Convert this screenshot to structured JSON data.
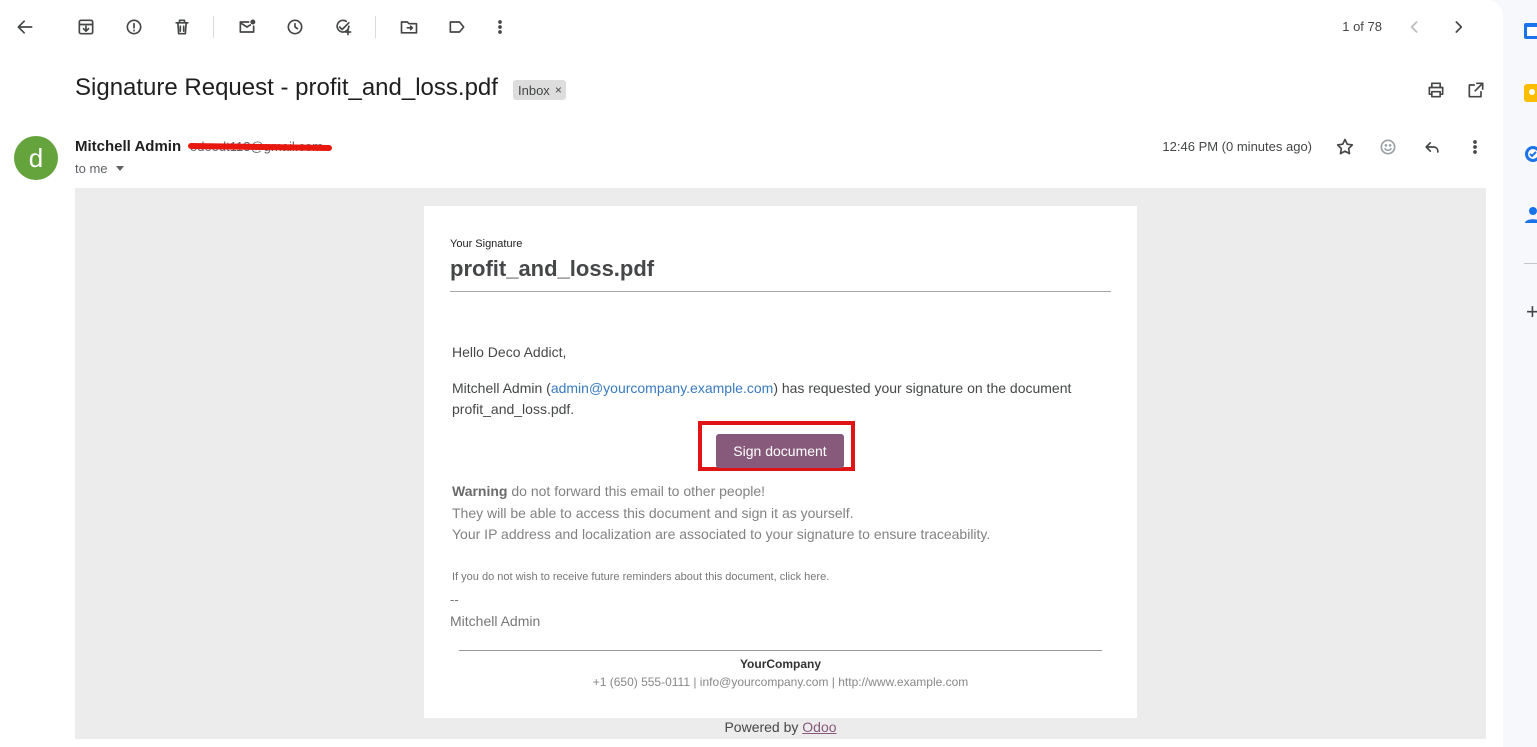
{
  "toolbar": {
    "icons": [
      "back-arrow-icon",
      "archive-icon",
      "report-spam-icon",
      "delete-icon",
      "mark-unread-icon",
      "snooze-icon",
      "add-to-tasks-icon",
      "move-to-icon",
      "label-icon",
      "more-vert-icon"
    ],
    "pager": {
      "text": "1 of 78"
    }
  },
  "message": {
    "subject": "Signature Request - profit_and_loss.pdf",
    "label_chip": "Inbox",
    "label_chip_close": "×",
    "avatar_letter": "d",
    "sender_name": "Mitchell Admin",
    "sender_email": "odoodt113@gmail.com",
    "recipient_text": "to me",
    "time": "12:46 PM (0 minutes ago)"
  },
  "email": {
    "pre_title": "Your Signature",
    "doc_title": "profit_and_loss.pdf",
    "greeting": "Hello Deco Addict,",
    "request_prefix": "Mitchell Admin (",
    "request_email": "admin@yourcompany.example.com",
    "request_suffix": ") has requested your signature on the document",
    "request_line2": "profit_and_loss.pdf.",
    "sign_button": "Sign document",
    "warning_bold": "Warning",
    "warning_rest": " do not forward this email to other people!",
    "warning_line2": "They will be able to access this document and sign it as yourself.",
    "warning_line3": "Your IP address and localization are associated to your signature to ensure traceability.",
    "reminder_text": "If you do not wish to receive future reminders about this document, click here.",
    "sig_dashes": "--",
    "sig_name": "Mitchell Admin",
    "company": "YourCompany",
    "contacts": "+1 (650) 555-0111 | info@yourcompany.com | http://www.example.com",
    "powered_prefix": "Powered by ",
    "powered_link": "Odoo"
  },
  "colors": {
    "accent_odoo": "#875a7b",
    "avatar_bg": "#65a33c",
    "redaction": "#e8180f",
    "highlight_frame": "#e01414"
  }
}
